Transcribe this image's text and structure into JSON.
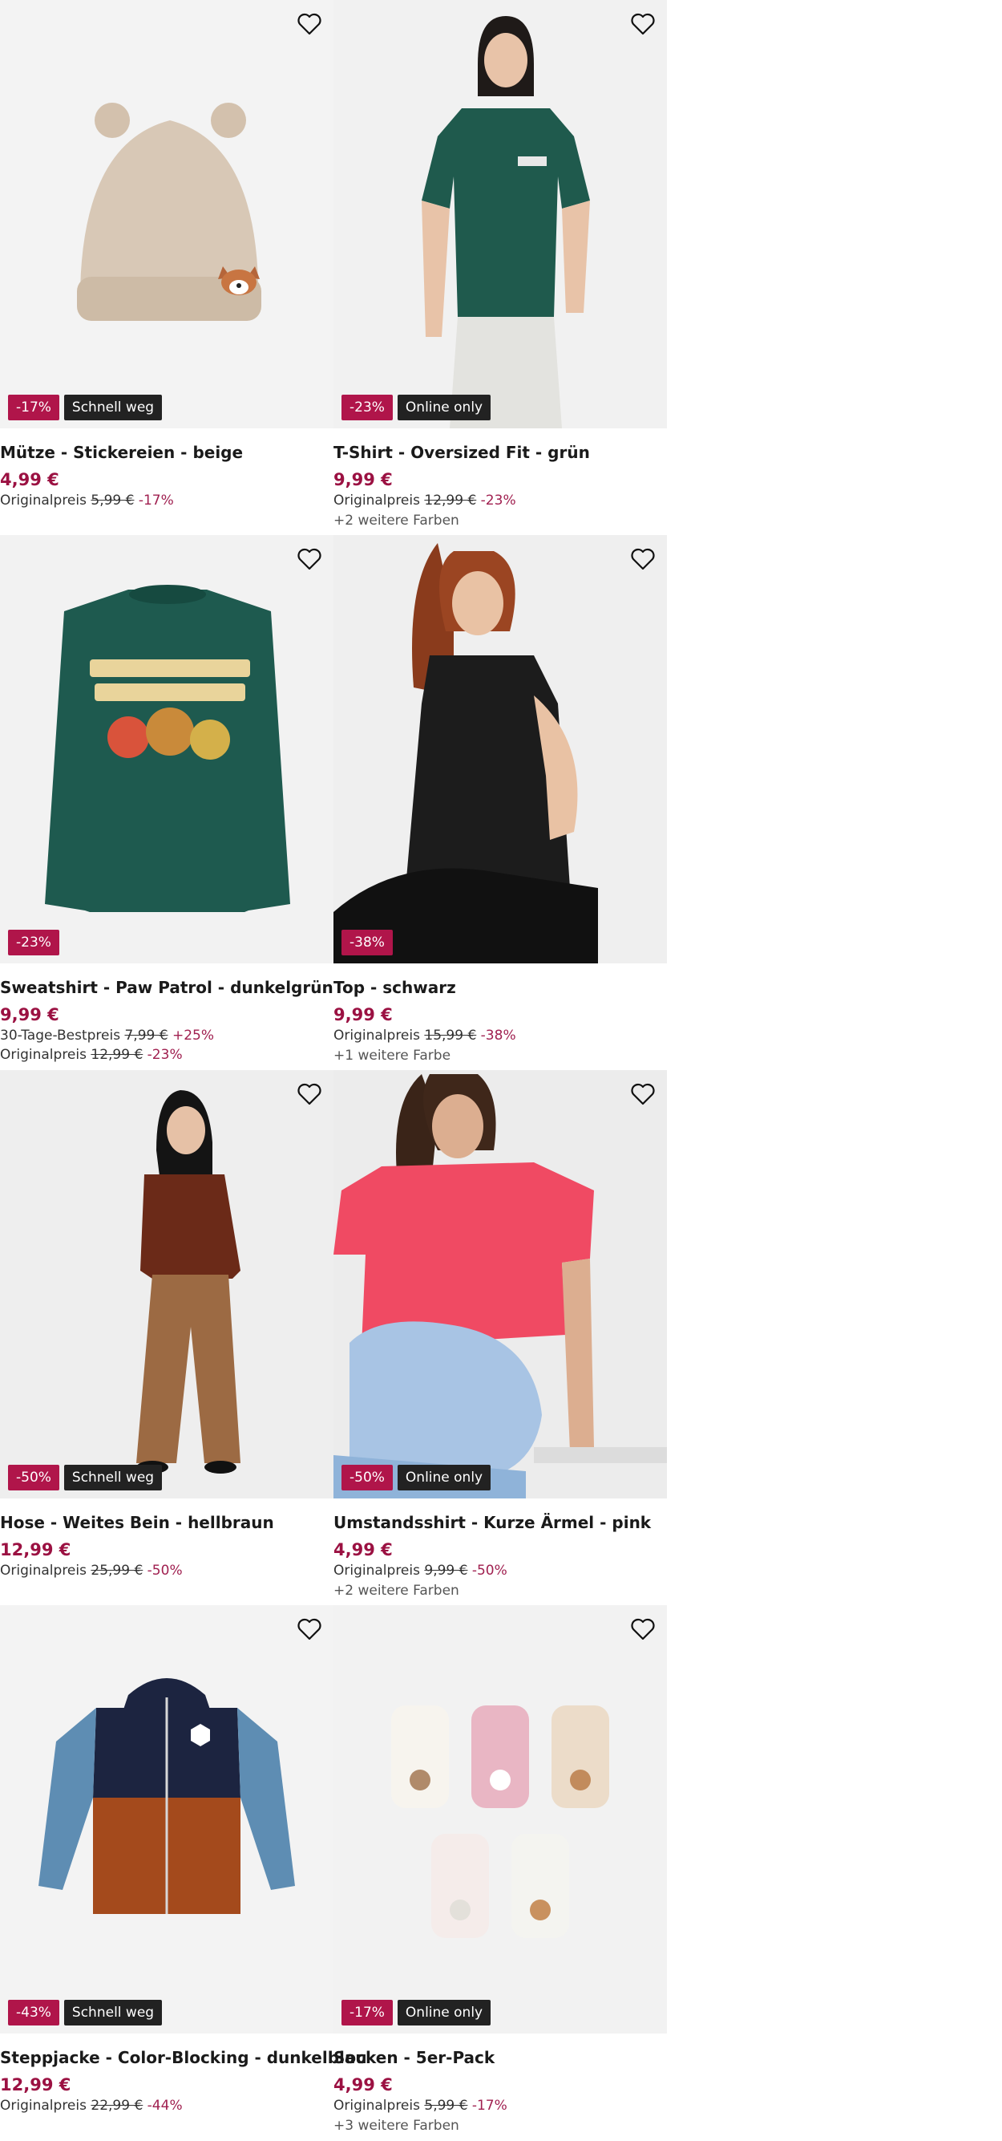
{
  "products": [
    {
      "title": "Mütze - Stickereien - beige",
      "price": "4,99 €",
      "badge_discount": "-17%",
      "badge_tag": "Schnell weg",
      "orig_label": "Originalpreis",
      "orig_price": "5,99 €",
      "orig_pct": "-17%",
      "more": ""
    },
    {
      "title": "T-Shirt - Oversized Fit - grün",
      "price": "9,99 €",
      "badge_discount": "-23%",
      "badge_tag": "Online only",
      "orig_label": "Originalpreis",
      "orig_price": "12,99 €",
      "orig_pct": "-23%",
      "more": "+2 weitere Farben"
    },
    {
      "title": "Sweatshirt - Paw Patrol - dunkelgrün",
      "price": "9,99 €",
      "badge_discount": "-23%",
      "badge_tag": "",
      "best_label": "30-Tage-Bestpreis",
      "best_price": "7,99 €",
      "best_pct": "+25%",
      "orig_label": "Originalpreis",
      "orig_price": "12,99 €",
      "orig_pct": "-23%",
      "more": ""
    },
    {
      "title": "Top - schwarz",
      "price": "9,99 €",
      "badge_discount": "-38%",
      "badge_tag": "",
      "orig_label": "Originalpreis",
      "orig_price": "15,99 €",
      "orig_pct": "-38%",
      "more": "+1 weitere Farbe"
    },
    {
      "title": "Hose - Weites Bein - hellbraun",
      "price": "12,99 €",
      "badge_discount": "-50%",
      "badge_tag": "Schnell weg",
      "orig_label": "Originalpreis",
      "orig_price": "25,99 €",
      "orig_pct": "-50%",
      "more": ""
    },
    {
      "title": "Umstandsshirt - Kurze Ärmel - pink",
      "price": "4,99 €",
      "badge_discount": "-50%",
      "badge_tag": "Online only",
      "orig_label": "Originalpreis",
      "orig_price": "9,99 €",
      "orig_pct": "-50%",
      "more": "+2 weitere Farben"
    },
    {
      "title": "Steppjacke - Color-Blocking - dunkelblau",
      "price": "12,99 €",
      "badge_discount": "-43%",
      "badge_tag": "Schnell weg",
      "orig_label": "Originalpreis",
      "orig_price": "22,99 €",
      "orig_pct": "-44%",
      "more": ""
    },
    {
      "title": "Socken - 5er-Pack",
      "price": "4,99 €",
      "badge_discount": "-17%",
      "badge_tag": "Online only",
      "orig_label": "Originalpreis",
      "orig_price": "5,99 €",
      "orig_pct": "-17%",
      "more": "+3 weitere Farben"
    }
  ],
  "colors": {
    "discount_badge": "#b0154a",
    "tag_badge": "#222222",
    "sale_price": "#9b1142"
  }
}
